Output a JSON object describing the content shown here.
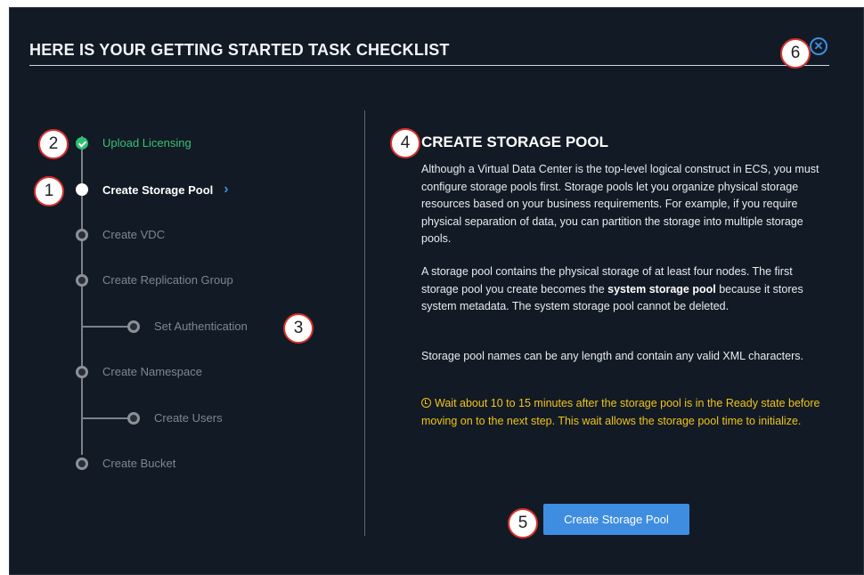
{
  "header": {
    "title": "HERE IS YOUR GETTING STARTED TASK CHECKLIST"
  },
  "callouts": [
    "1",
    "2",
    "3",
    "4",
    "5",
    "6"
  ],
  "checklist": {
    "steps": [
      {
        "label": "Upload Licensing",
        "status": "done"
      },
      {
        "label": "Create Storage Pool",
        "status": "current"
      },
      {
        "label": "Create VDC",
        "status": "pending"
      },
      {
        "label": "Create Replication Group",
        "status": "pending"
      },
      {
        "label": "Set Authentication",
        "status": "pending"
      },
      {
        "label": "Create Namespace",
        "status": "pending"
      },
      {
        "label": "Create Users",
        "status": "pending"
      },
      {
        "label": "Create Bucket",
        "status": "pending"
      }
    ]
  },
  "content": {
    "title": "CREATE STORAGE POOL",
    "para1": "Although a Virtual Data Center is the top-level logical construct in ECS, you must configure storage pools first. Storage pools let you organize physical storage resources based on your business requirements. For example, if you require physical separation of data, you can partition the storage into multiple storage pools.",
    "para2_before": "A storage pool contains the physical storage of at least four nodes. The first storage pool you create becomes the ",
    "para2_bold": "system storage pool",
    "para2_after": " because it stores system metadata. The system storage pool cannot be deleted.",
    "para3": "Storage pool names can be any length and contain any valid XML characters.",
    "warning": "Wait about 10 to 15 minutes after the storage pool is in the Ready state before moving on to the next step. This wait allows the storage pool time to initialize."
  },
  "actions": {
    "primary_label": "Create Storage Pool"
  },
  "colors": {
    "background": "#121a25",
    "accent": "#3f8de0",
    "done": "#38c172",
    "warning": "#f0c419",
    "callout_border": "#d8322b"
  },
  "icons": {
    "close": "close-circle-icon",
    "done": "check-circle-icon",
    "current": "chevron-right-icon",
    "warning": "clock-icon"
  }
}
